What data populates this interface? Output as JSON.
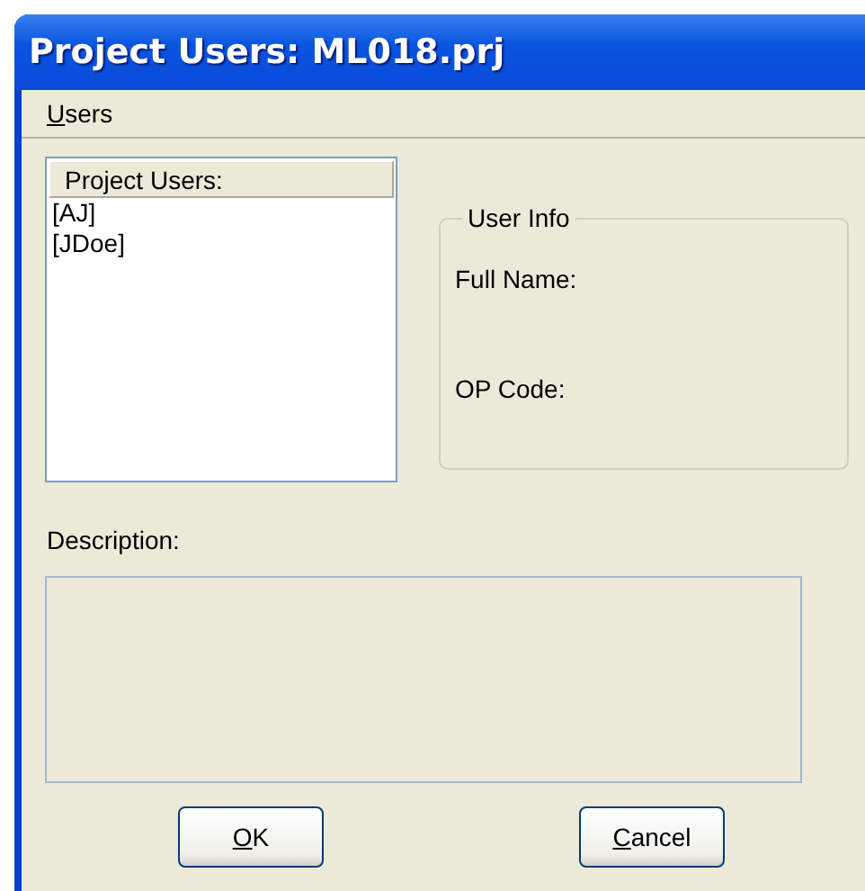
{
  "window": {
    "title": "Project Users: ML018.prj"
  },
  "menu": [
    {
      "key": "U",
      "rest": "sers"
    }
  ],
  "user_list": {
    "header": "Project Users:",
    "items": [
      {
        "label": "[AJ]",
        "selected": false
      },
      {
        "label": "[JDoe]",
        "selected": false
      }
    ]
  },
  "user_info": {
    "title": "User Info",
    "fields": [
      "Full Name:",
      "OP Code:"
    ]
  },
  "description": {
    "label": "Description:"
  },
  "buttons": [
    {
      "key": "O",
      "rest": "K"
    },
    {
      "key": "C",
      "rest": "ancel"
    }
  ]
}
